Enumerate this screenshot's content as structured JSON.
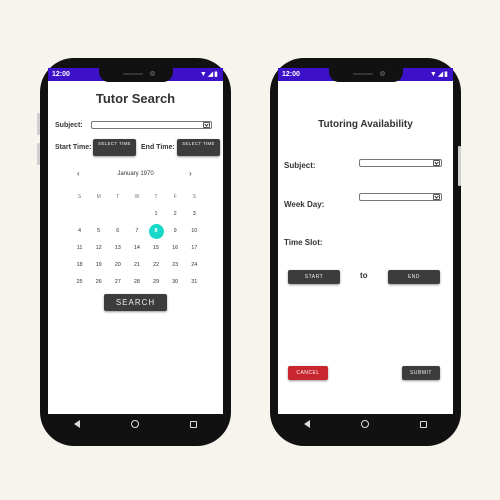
{
  "left_phone": {
    "status_time": "12:00",
    "title": "Tutor Search",
    "subject_label": "Subject:",
    "start_time_label": "Start Time:",
    "start_time_button": "SELECT TIME",
    "end_time_label": "End Time:",
    "end_time_button": "SELECT TIME",
    "calendar": {
      "month_label": "January 1970",
      "prev_arrow": "‹",
      "next_arrow": "›",
      "weekdays": [
        "S",
        "M",
        "T",
        "W",
        "T",
        "F",
        "S"
      ],
      "weeks": [
        [
          "",
          "",
          "",
          "",
          "1",
          "2",
          "3"
        ],
        [
          "4",
          "5",
          "6",
          "7",
          "8",
          "9",
          "10"
        ],
        [
          "11",
          "12",
          "13",
          "14",
          "15",
          "16",
          "17"
        ],
        [
          "18",
          "19",
          "20",
          "21",
          "22",
          "23",
          "24"
        ],
        [
          "25",
          "26",
          "27",
          "28",
          "29",
          "30",
          "31"
        ]
      ],
      "selected_day": "8",
      "accent_color": "#18d9c9"
    },
    "search_button": "SEARCH"
  },
  "right_phone": {
    "status_time": "12:00",
    "title": "Tutoring Availability",
    "subject_label": "Subject:",
    "weekday_label": "Week Day:",
    "timeslot_label": "Time Slot:",
    "start_button": "START",
    "to_label": "to",
    "end_button": "END",
    "cancel_button": "CANCEL",
    "submit_button": "SUBMIT",
    "cancel_color": "#c8262f"
  },
  "status_bar_color": "#3d10c9"
}
